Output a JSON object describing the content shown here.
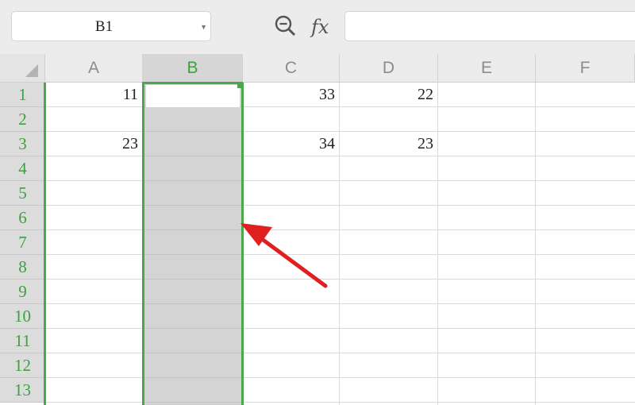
{
  "formula_bar": {
    "name_box": "B1",
    "zoom_icon": "zoom-in-icon",
    "fx_label": "fx",
    "formula_value": ""
  },
  "columns": [
    "A",
    "B",
    "C",
    "D",
    "E",
    "F"
  ],
  "selected_column": "B",
  "rows": [
    "1",
    "2",
    "3",
    "4",
    "5",
    "6",
    "7",
    "8",
    "9",
    "10",
    "11",
    "12",
    "13"
  ],
  "cells": {
    "A1": "11",
    "C1": "33",
    "D1": "22",
    "A3": "23",
    "C3": "34",
    "D3": "23"
  },
  "colors": {
    "selection": "#4aa84a",
    "selected_column_fill": "#d4d4d4",
    "arrow": "#e02020"
  },
  "annotation": "red-arrow-pointing-at-column-B-right-border"
}
